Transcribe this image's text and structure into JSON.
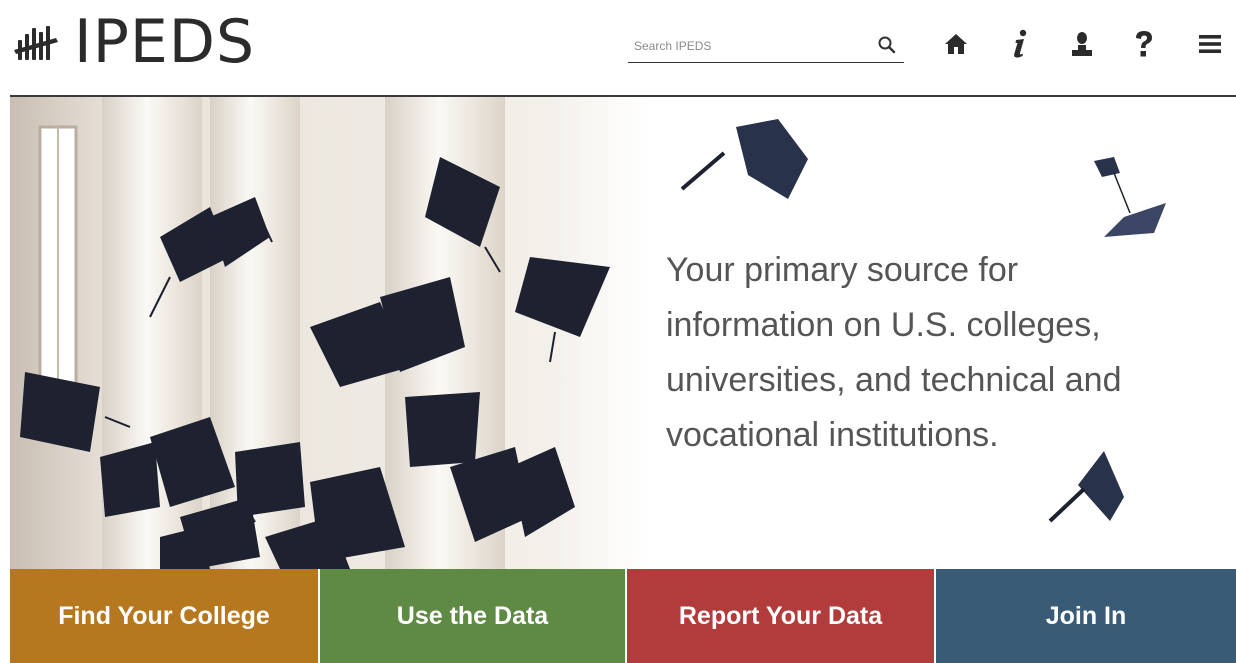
{
  "header": {
    "logo_text": "IPEDS",
    "logo_icon": "bar-chart-hand-icon",
    "search": {
      "placeholder": "Search IPEDS",
      "value": "",
      "icon": "search-icon"
    },
    "icons": [
      "home-icon",
      "info-icon",
      "user-icon",
      "help-icon",
      "menu-icon"
    ]
  },
  "hero": {
    "tagline": "Your primary source for information on U.S. colleges, universities, and technical and vocational institutions."
  },
  "tiles": [
    {
      "label": "Find Your College",
      "color": "#b5781f"
    },
    {
      "label": "Use the Data",
      "color": "#5e8a44"
    },
    {
      "label": "Report Your Data",
      "color": "#b23b3b"
    },
    {
      "label": "Join In",
      "color": "#3a5b76"
    }
  ],
  "colors": {
    "text_dark": "#2b2b2b",
    "tagline": "#555555",
    "rule": "#3a3a3a"
  }
}
